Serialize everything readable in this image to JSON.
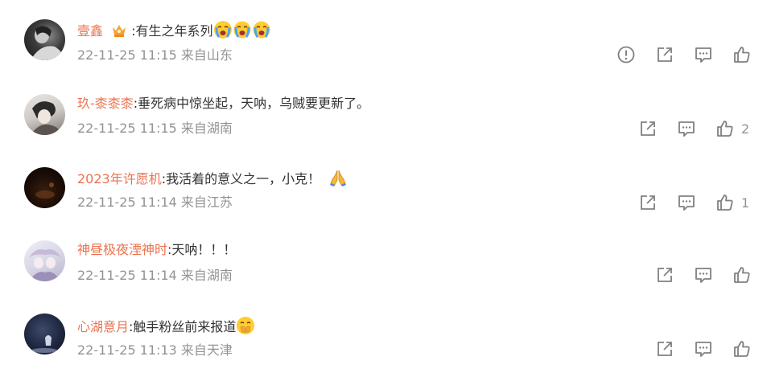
{
  "comments": [
    {
      "username": "壹鑫",
      "text": ":有生之年系列",
      "time": "22-11-25 11:15",
      "location": "来自山东",
      "badge_icon": "crown-badge-icon",
      "emojis": [
        "crying-emoji",
        "crying-emoji",
        "crying-emoji"
      ],
      "actions": [
        "report-icon",
        "share-icon",
        "reply-icon",
        "like-icon"
      ],
      "like_count": ""
    },
    {
      "username": "玖-桼桼桼",
      "text": ":垂死病中惊坐起，天呐，乌贼要更新了。",
      "time": "22-11-25 11:15",
      "location": "来自湖南",
      "emojis": [],
      "actions": [
        "share-icon",
        "reply-icon",
        "like-icon"
      ],
      "like_count": "2"
    },
    {
      "username": "2023年许愿机",
      "text": ":我活着的意义之一，小克！",
      "time": "22-11-25 11:14",
      "location": "来自江苏",
      "emojis": [
        "praying-hands-emoji"
      ],
      "actions": [
        "share-icon",
        "reply-icon",
        "like-icon"
      ],
      "like_count": "1"
    },
    {
      "username": "神昼极夜湮神时",
      "text": ":天呐！！！",
      "time": "22-11-25 11:14",
      "location": "来自湖南",
      "emojis": [],
      "actions": [
        "share-icon",
        "reply-icon",
        "like-icon"
      ],
      "like_count": ""
    },
    {
      "username": "心湖意月",
      "text": ":触手粉丝前来报道",
      "time": "22-11-25 11:13",
      "location": "来自天津",
      "emojis": [
        "face-with-hand-over-mouth-emoji"
      ],
      "actions": [
        "share-icon",
        "reply-icon",
        "like-icon"
      ],
      "like_count": ""
    }
  ],
  "colors": {
    "username": "#eb7350",
    "text": "#333333",
    "meta": "#939393",
    "icon": "#808080"
  }
}
